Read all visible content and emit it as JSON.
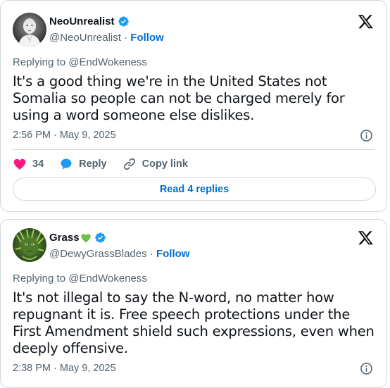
{
  "tweets": [
    {
      "name": "NeoUnrealist",
      "handle": "@NeoUnrealist",
      "separator": "·",
      "follow_label": "Follow",
      "replying": "Replying to @EndWokeness",
      "text": "It's a good thing we're in the United States not Somalia so people can not be charged merely for using a word someone else dislikes.",
      "timestamp": "2:56 PM · May 9, 2025",
      "likes": "34",
      "reply_label": "Reply",
      "copy_label": "Copy link",
      "read_replies_label": "Read 4 replies",
      "avatar_icon": "statue-avatar",
      "verified_icon": "verified-badge-icon",
      "platform_icon": "x-logo-icon"
    },
    {
      "name": "Grass",
      "name_emoji": "green-heart",
      "handle": "@DewyGrassBlades",
      "separator": "·",
      "follow_label": "Follow",
      "replying": "Replying to @EndWokeness",
      "text": "It's not illegal to say the N-word, no matter how repugnant it is. Free speech protections under the First Amendment shield such expressions, even when deeply offensive.",
      "timestamp": "2:38 PM · May 9, 2025",
      "avatar_icon": "grass-face-avatar",
      "verified_icon": "verified-badge-icon",
      "platform_icon": "x-logo-icon"
    }
  ],
  "colors": {
    "link_blue": "#006fd6",
    "verified_blue": "#1d9bf0",
    "secondary_text": "#536471",
    "heart_pink": "#f91880",
    "border": "#cfd9de",
    "emoji_green": "#6cc04a"
  }
}
